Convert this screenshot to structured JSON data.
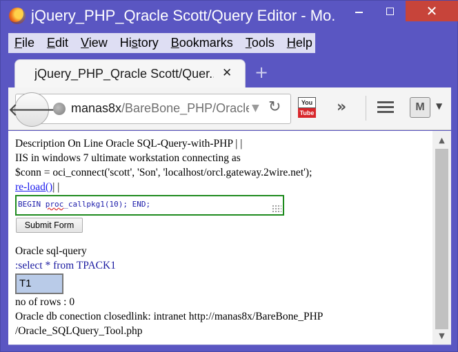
{
  "window": {
    "title": "jQuery_PHP_Qracle Scott/Query Editor - Mo...",
    "close_glyph": "✕"
  },
  "menu": [
    {
      "pre": "",
      "u": "F",
      "post": "ile"
    },
    {
      "pre": "",
      "u": "E",
      "post": "dit"
    },
    {
      "pre": "",
      "u": "V",
      "post": "iew"
    },
    {
      "pre": "Hi",
      "u": "s",
      "post": "tory"
    },
    {
      "pre": "",
      "u": "B",
      "post": "ookmarks"
    },
    {
      "pre": "",
      "u": "T",
      "post": "ools"
    },
    {
      "pre": "",
      "u": "H",
      "post": "elp"
    }
  ],
  "tab": {
    "title": "jQuery_PHP_Qracle Scott/Quer...",
    "close_glyph": "✕",
    "new_tab_glyph": "+"
  },
  "toolbar": {
    "back_glyph": "🡐",
    "url_host": "manas8x",
    "url_path": "/BareBone_PHP/Oracle",
    "youtube_top": "You",
    "youtube_bottom": "Tube",
    "overflow_glyph": "»",
    "shield_label": "M"
  },
  "page": {
    "line1": "Description On Line Oracle SQL-Query-with-PHP | |",
    "line2": "IIS in windows 7 ultimate workstation connecting as",
    "line3": "$conn = oci_connect('scott', 'Son', 'localhost/orcl.gateway.2wire.net');",
    "reload_link": "re-load()",
    "reload_suffix": "| |",
    "query_pre": "BEGIN ",
    "query_squiggle": "proc",
    "query_post": "_callpkg1(10); END;",
    "submit_label": "Submit Form",
    "oracle_label": "Oracle sql-query",
    "select_query": ":select * from TPACK1",
    "table_value": "T1",
    "rows": "no of rows : 0",
    "closed_line1": "Oracle db conection closedlink: intranet http://manas8x/BareBone_PHP",
    "closed_line2": "/Oracle_SQLQuery_Tool.php"
  },
  "colors": {
    "window_frame": "#5a56c2",
    "close_button": "#c7443a",
    "input_border": "#1d8a1d",
    "link": "#1a1aee"
  },
  "icons": [
    "firefox-logo-icon",
    "minimize-icon",
    "maximize-icon",
    "close-icon",
    "back-arrow-icon",
    "globe-icon",
    "dropdown-icon",
    "reload-icon",
    "youtube-icon",
    "overflow-chevron-icon",
    "hamburger-menu-icon",
    "shield-icon"
  ]
}
